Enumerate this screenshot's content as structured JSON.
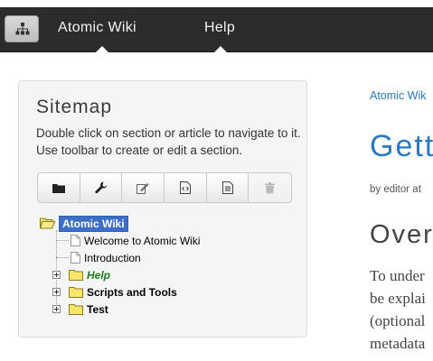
{
  "navbar": {
    "home_icon": "sitemap-icon",
    "items": [
      {
        "label": "Atomic Wiki"
      },
      {
        "label": "Help"
      }
    ]
  },
  "sitemap": {
    "title": "Sitemap",
    "description": "Double click on section or article to navigate to it. Use toolbar to create or edit a section.",
    "toolbar": [
      {
        "icon": "folder-icon",
        "enabled": true
      },
      {
        "icon": "wrench-icon",
        "enabled": true
      },
      {
        "icon": "edit-icon",
        "enabled": true
      },
      {
        "icon": "code-document-icon",
        "enabled": true
      },
      {
        "icon": "document-icon",
        "enabled": true
      },
      {
        "icon": "trash-icon",
        "enabled": false
      }
    ],
    "tree": {
      "root": {
        "label": "Atomic Wiki",
        "selected": true
      },
      "articles": [
        {
          "label": "Welcome to Atomic Wiki"
        },
        {
          "label": "Introduction"
        }
      ],
      "sections": [
        {
          "label": "Help",
          "highlight": "#1f7a1f"
        },
        {
          "label": "Scripts and Tools"
        },
        {
          "label": "Test"
        }
      ]
    }
  },
  "content": {
    "breadcrumb": "Atomic Wik",
    "title": "Gett",
    "byline": "by editor at",
    "section_title": "Over",
    "body_lines": [
      "To under",
      "be explai",
      "(optional",
      "metadata"
    ]
  },
  "colors": {
    "accent": "#2a78c2",
    "navbar": "#2a2a2a",
    "selection": "#3d6fc8"
  }
}
